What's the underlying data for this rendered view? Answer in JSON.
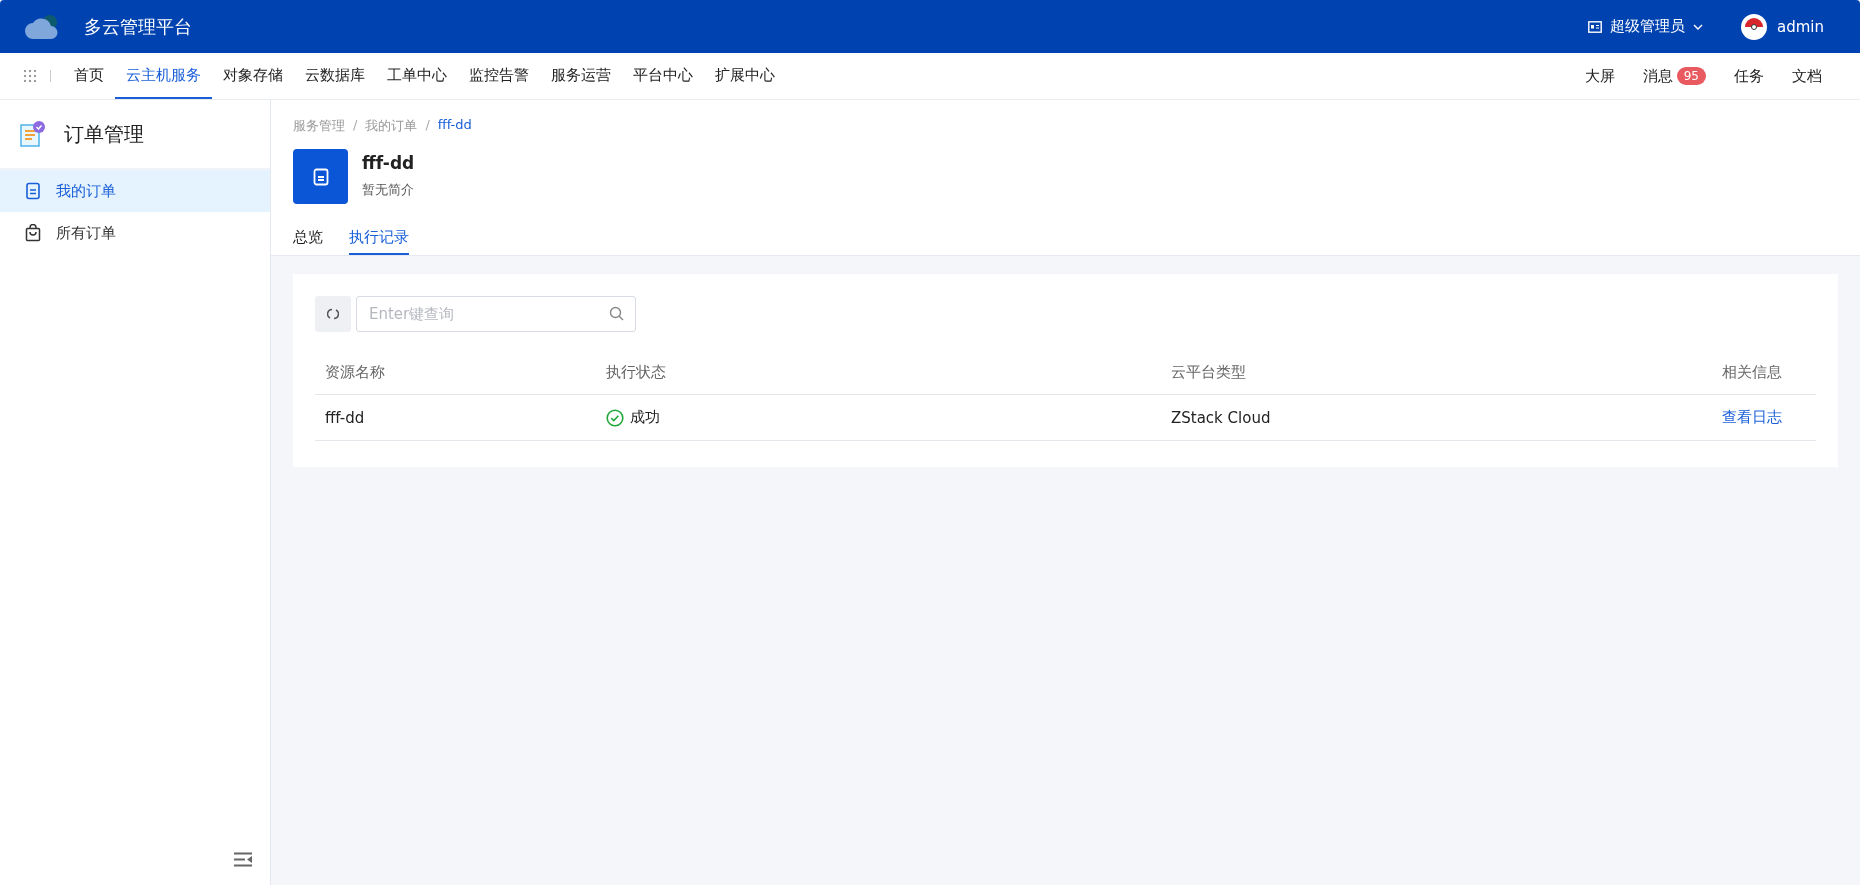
{
  "header": {
    "title": "多云管理平台",
    "role": "超级管理员",
    "user": "admin"
  },
  "nav": {
    "items": [
      {
        "label": "首页",
        "selected": false
      },
      {
        "label": "云主机服务",
        "selected": true
      },
      {
        "label": "对象存储",
        "selected": false
      },
      {
        "label": "云数据库",
        "selected": false
      },
      {
        "label": "工单中心",
        "selected": false
      },
      {
        "label": "监控告警",
        "selected": false
      },
      {
        "label": "服务运营",
        "selected": false
      },
      {
        "label": "平台中心",
        "selected": false
      },
      {
        "label": "扩展中心",
        "selected": false
      }
    ],
    "right": [
      {
        "label": "大屏"
      },
      {
        "label": "消息",
        "badge": "95"
      },
      {
        "label": "任务"
      },
      {
        "label": "文档"
      }
    ]
  },
  "sidebar": {
    "title": "订单管理",
    "items": [
      {
        "label": "我的订单",
        "selected": true
      },
      {
        "label": "所有订单",
        "selected": false
      }
    ]
  },
  "breadcrumb": {
    "items": [
      "服务管理",
      "我的订单",
      "fff-dd"
    ],
    "separators": [
      "/",
      "/"
    ]
  },
  "resource": {
    "name": "fff-dd",
    "description": "暂无简介"
  },
  "tabs": [
    {
      "label": "总览",
      "selected": false
    },
    {
      "label": "执行记录",
      "selected": true
    }
  ],
  "search": {
    "placeholder": "Enter键查询"
  },
  "table": {
    "columns": [
      "资源名称",
      "执行状态",
      "云平台类型",
      "相关信息"
    ],
    "rows": [
      {
        "name": "fff-dd",
        "status": {
          "kind": "success",
          "label": "成功"
        },
        "platform": "ZStack Cloud",
        "action": "查看日志"
      }
    ]
  }
}
